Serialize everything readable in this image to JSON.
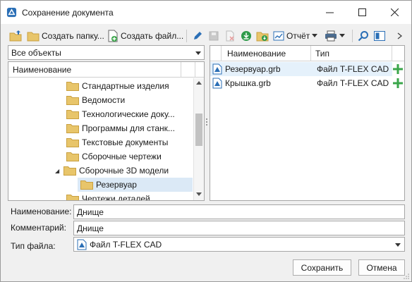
{
  "window": {
    "title": "Сохранение документа",
    "controls": {
      "minimize": "—",
      "maximize": "☐",
      "close": "✕"
    }
  },
  "toolbar": {
    "create_folder_label": "Создать папку...",
    "create_file_label": "Создать файл...",
    "report_label": "Отчёт"
  },
  "filter": {
    "value": "Все объекты"
  },
  "tree": {
    "header": "Наименование",
    "items": [
      {
        "label": "Стандартные изделия"
      },
      {
        "label": "Ведомости"
      },
      {
        "label": "Технологические доку..."
      },
      {
        "label": "Программы для станк..."
      },
      {
        "label": "Текстовые документы"
      },
      {
        "label": "Сборочные чертежи"
      },
      {
        "label": "Сборочные 3D модели",
        "expand_glyph": "◢"
      },
      {
        "label": "Резервуар"
      },
      {
        "label": "Чертежи деталей"
      }
    ]
  },
  "files": {
    "headers": {
      "name": "Наименование",
      "type": "Тип"
    },
    "rows": [
      {
        "name": "Резервуар.grb",
        "type": "Файл T-FLEX CAD"
      },
      {
        "name": "Крышка.grb",
        "type": "Файл T-FLEX CAD"
      }
    ]
  },
  "form": {
    "name_label": "Наименование:",
    "name_value": "Днище",
    "comment_label": "Комментарий:",
    "comment_value": "Днище",
    "filetype_label": "Тип файла:",
    "filetype_value": "Файл T-FLEX CAD"
  },
  "buttons": {
    "save": "Сохранить",
    "cancel": "Отмена"
  },
  "colors": {
    "folder": "#e8c56a",
    "accent_blue": "#2b6fb6",
    "add_green": "#3aa64a",
    "selection": "#e5f1fb",
    "tree_selection": "#dbe9f6"
  }
}
